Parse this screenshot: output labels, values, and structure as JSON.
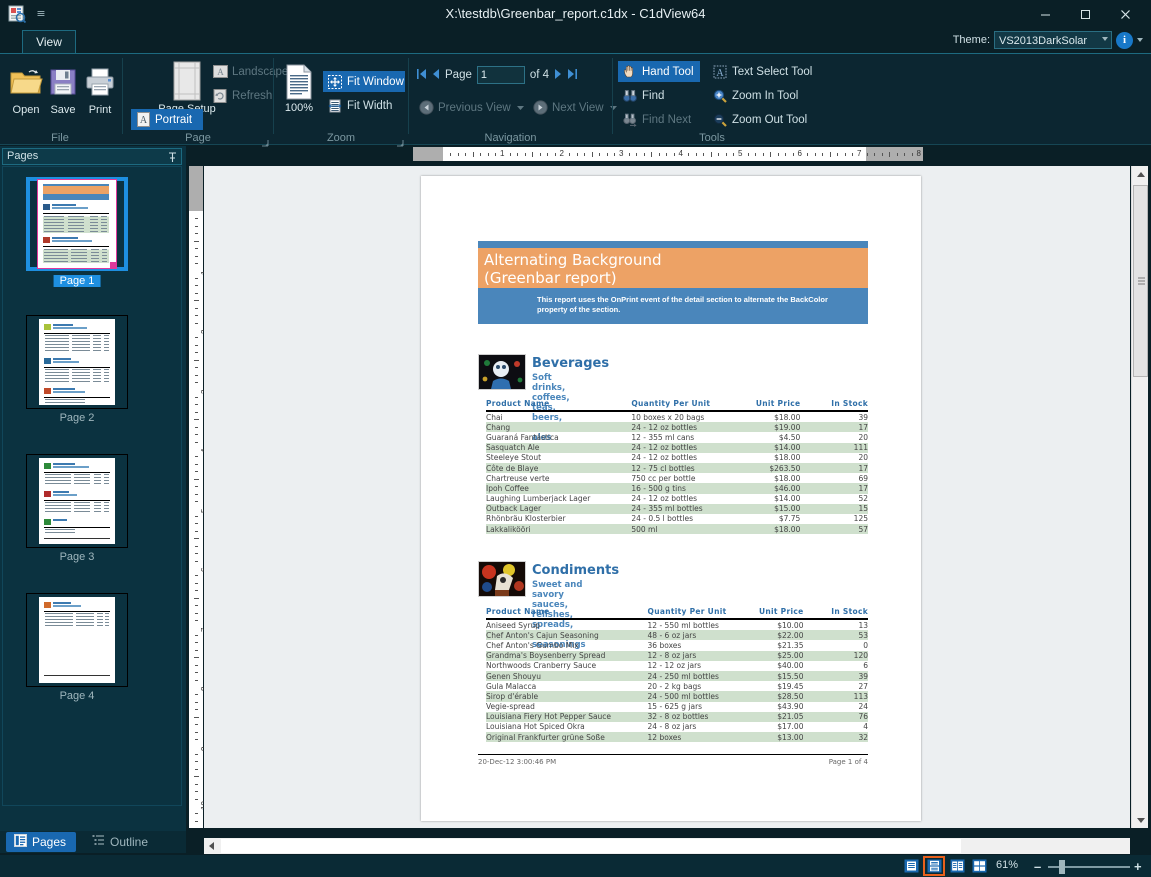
{
  "window": {
    "title": "X:\\testdb\\Greenbar_report.c1dx - C1dView64",
    "minimize": "–",
    "maximize": "☐",
    "close": "✕",
    "app_icon": "report-viewer-icon",
    "quick_access_icon": "quick-access-toolbar-icon"
  },
  "ribbon": {
    "tabs": [
      {
        "label": "View",
        "active": true
      }
    ],
    "theme": {
      "label": "Theme:",
      "value": "VS2013DarkSolar",
      "info_label": "i"
    },
    "groups": [
      {
        "name": "File"
      },
      {
        "name": "Page"
      },
      {
        "name": "Zoom"
      },
      {
        "name": "Navigation"
      },
      {
        "name": "Tools"
      }
    ],
    "file": {
      "open": "Open",
      "save": "Save",
      "print": "Print"
    },
    "page": {
      "page_setup": "Page Setup",
      "portrait": "Portrait",
      "landscape": "Landscape",
      "refresh": "Refresh"
    },
    "zoom": {
      "percent": "100%",
      "fit_window": "Fit Window",
      "fit_width": "Fit Width"
    },
    "navigation": {
      "first": "first-page",
      "prev": "previous-page",
      "page_label": "Page",
      "page_value": "1",
      "of_label": "of 4",
      "next": "next-page",
      "last": "last-page",
      "previous_view": "Previous View",
      "next_view": "Next View"
    },
    "tools": {
      "hand_tool": "Hand Tool",
      "find": "Find",
      "find_next": "Find Next",
      "text_select_tool": "Text Select Tool",
      "zoom_in_tool": "Zoom In Tool",
      "zoom_out_tool": "Zoom Out Tool"
    }
  },
  "left_pane": {
    "header": "Pages",
    "pin_icon": "pin-icon",
    "thumbnails": [
      {
        "label": "Page 1",
        "selected": true
      },
      {
        "label": "Page 2",
        "selected": false
      },
      {
        "label": "Page 3",
        "selected": false
      },
      {
        "label": "Page 4",
        "selected": false
      }
    ],
    "tabs": [
      {
        "label": "Pages",
        "active": true,
        "icon": "pages-icon"
      },
      {
        "label": "Outline",
        "active": false,
        "icon": "outline-tree-icon"
      }
    ]
  },
  "rulers": {
    "horizontal_labels": [
      "1",
      "2",
      "3",
      "4",
      "5",
      "6",
      "7",
      "8"
    ],
    "vertical_labels": [
      "1",
      "2",
      "3",
      "4",
      "5",
      "6",
      "7",
      "8",
      "9",
      "10"
    ]
  },
  "document": {
    "title_line1": "Alternating Background",
    "title_line2": "(Greenbar report)",
    "subtitle": "This report uses the OnPrint event of the detail section to alternate the BackColor property of the section.",
    "columns": [
      "Product Name",
      "Quantity Per Unit",
      "Unit Price",
      "In Stock"
    ],
    "categories": [
      {
        "name": "Beverages",
        "description": "Soft drinks, coffees, teas, beers, and ales",
        "rows": [
          [
            "Chai",
            "10 boxes x 20 bags",
            "$18.00",
            "39"
          ],
          [
            "Chang",
            "24 - 12 oz bottles",
            "$19.00",
            "17"
          ],
          [
            "Guaraná Fantástica",
            "12 - 355 ml cans",
            "$4.50",
            "20"
          ],
          [
            "Sasquatch Ale",
            "24 - 12 oz bottles",
            "$14.00",
            "111"
          ],
          [
            "Steeleye Stout",
            "24 - 12 oz bottles",
            "$18.00",
            "20"
          ],
          [
            "Côte de Blaye",
            "12 - 75 cl bottles",
            "$263.50",
            "17"
          ],
          [
            "Chartreuse verte",
            "750 cc per bottle",
            "$18.00",
            "69"
          ],
          [
            "Ipoh Coffee",
            "16 - 500 g tins",
            "$46.00",
            "17"
          ],
          [
            "Laughing Lumberjack Lager",
            "24 - 12 oz bottles",
            "$14.00",
            "52"
          ],
          [
            "Outback Lager",
            "24 - 355 ml bottles",
            "$15.00",
            "15"
          ],
          [
            "Rhönbräu Klosterbier",
            "24 - 0.5 l bottles",
            "$7.75",
            "125"
          ],
          [
            "Lakkalikööri",
            "500 ml",
            "$18.00",
            "57"
          ]
        ]
      },
      {
        "name": "Condiments",
        "description": "Sweet and savory sauces, relishes, spreads, and seasonings",
        "rows": [
          [
            "Aniseed Syrup",
            "12 - 550 ml bottles",
            "$10.00",
            "13"
          ],
          [
            "Chef Anton's Cajun Seasoning",
            "48 - 6 oz jars",
            "$22.00",
            "53"
          ],
          [
            "Chef Anton's Gumbo Mix",
            "36 boxes",
            "$21.35",
            "0"
          ],
          [
            "Grandma's Boysenberry Spread",
            "12 - 8 oz jars",
            "$25.00",
            "120"
          ],
          [
            "Northwoods Cranberry Sauce",
            "12 - 12 oz jars",
            "$40.00",
            "6"
          ],
          [
            "Genen Shouyu",
            "24 - 250 ml bottles",
            "$15.50",
            "39"
          ],
          [
            "Gula Malacca",
            "20 - 2 kg bags",
            "$19.45",
            "27"
          ],
          [
            "Sirop d'érable",
            "24 - 500 ml bottles",
            "$28.50",
            "113"
          ],
          [
            "Vegie-spread",
            "15 - 625 g jars",
            "$43.90",
            "24"
          ],
          [
            "Louisiana Fiery Hot Pepper Sauce",
            "32 - 8 oz bottles",
            "$21.05",
            "76"
          ],
          [
            "Louisiana Hot Spiced Okra",
            "24 - 8 oz jars",
            "$17.00",
            "4"
          ],
          [
            "Original Frankfurter grüne Soße",
            "12 boxes",
            "$13.00",
            "32"
          ]
        ]
      }
    ],
    "footer_left": "20-Dec-12 3:00:46 PM",
    "footer_right": "Page 1 of 4"
  },
  "statusbar": {
    "view_modes": [
      {
        "icon": "single-page-view-icon",
        "selected": false
      },
      {
        "icon": "continuous-page-view-icon",
        "selected": true
      },
      {
        "icon": "two-page-view-icon",
        "selected": false
      },
      {
        "icon": "grid-page-view-icon",
        "selected": false
      }
    ],
    "zoom_percent": "61%",
    "zoom_out": "–",
    "zoom_in": "+"
  },
  "colors": {
    "chrome_bg": "#0a1f26",
    "ribbon_bg": "#0c2631",
    "panel_bg": "#0b3240",
    "accent": "#1968b0",
    "selection_orange": "#e8601c",
    "report_title_bg": "#eda265",
    "report_band_blue": "#4a86bb",
    "greenbar": "#cfe0cd"
  }
}
